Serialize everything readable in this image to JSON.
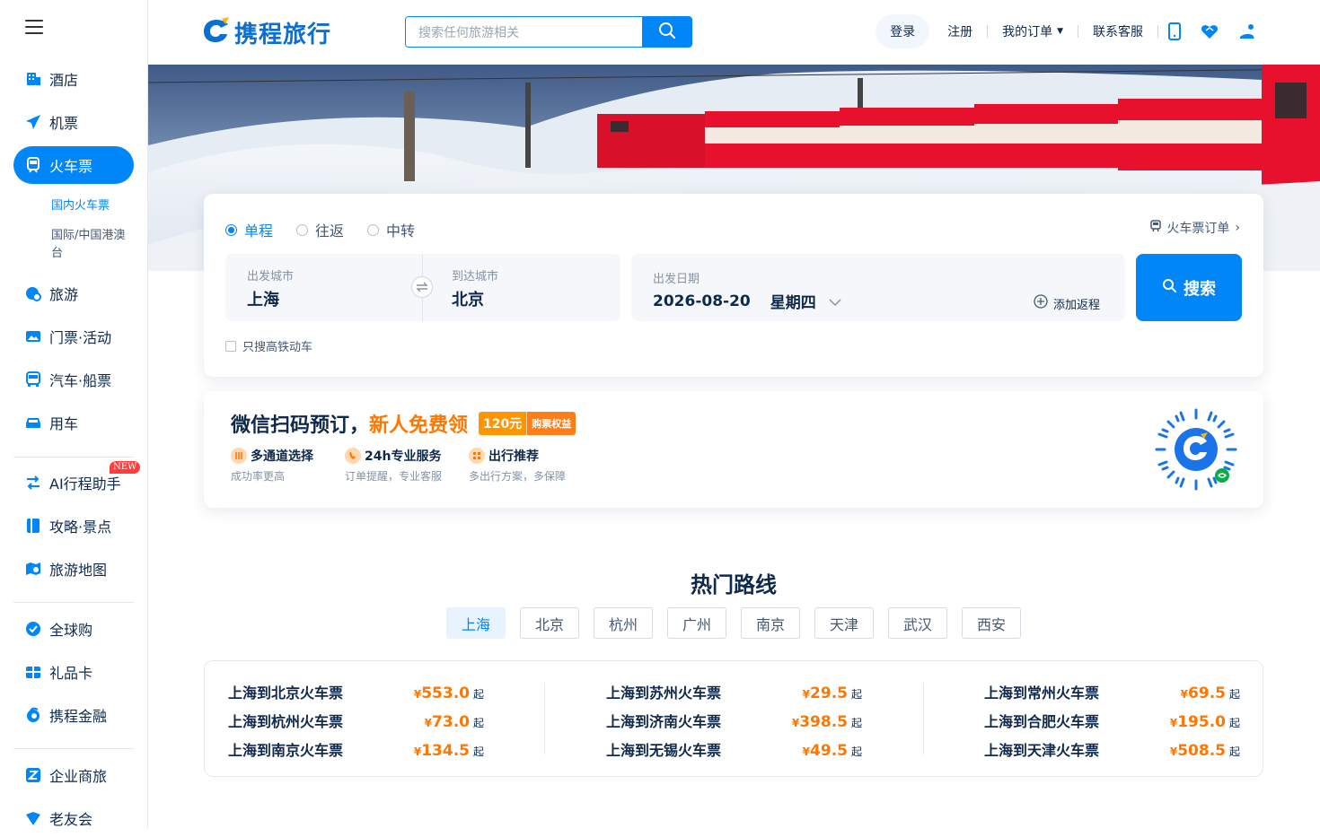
{
  "sidebar": {
    "items": [
      {
        "label": "酒店",
        "icon": "hotel-icon"
      },
      {
        "label": "机票",
        "icon": "plane-icon"
      },
      {
        "label": "火车票",
        "icon": "train-icon",
        "active": true
      },
      {
        "label": "旅游",
        "icon": "travel-icon"
      },
      {
        "label": "门票·活动",
        "icon": "ticket-icon"
      },
      {
        "label": "汽车·船票",
        "icon": "bus-icon"
      },
      {
        "label": "用车",
        "icon": "car-icon"
      },
      {
        "label": "AI行程助手",
        "icon": "ai-assistant-icon",
        "badge": "NEW"
      },
      {
        "label": "攻略·景点",
        "icon": "guide-icon"
      },
      {
        "label": "旅游地图",
        "icon": "map-icon"
      },
      {
        "label": "全球购",
        "icon": "global-shop-icon"
      },
      {
        "label": "礼品卡",
        "icon": "gift-card-icon"
      },
      {
        "label": "携程金融",
        "icon": "finance-icon"
      },
      {
        "label": "企业商旅",
        "icon": "business-icon"
      },
      {
        "label": "老友会",
        "icon": "member-icon"
      }
    ],
    "sub_items": [
      {
        "label": "国内火车票",
        "active": true
      },
      {
        "label": "国际/中国港澳台"
      }
    ],
    "new_badge": "NEW"
  },
  "header": {
    "logo_text": "携程旅行",
    "search_placeholder": "搜索任何旅游相关",
    "login": "登录",
    "register": "注册",
    "my_orders": "我的订单",
    "service": "联系客服"
  },
  "search": {
    "trip_types": [
      "单程",
      "往返",
      "中转"
    ],
    "orders_link": "火车票订单",
    "from_label": "出发城市",
    "from_value": "上海",
    "to_label": "到达城市",
    "to_value": "北京",
    "date_label": "出发日期",
    "date_value": "2026-08-20",
    "weekday": "星期四",
    "add_return": "添加返程",
    "search_button": "搜索",
    "high_speed_only": "只搜高铁动车"
  },
  "promo": {
    "title_a": "微信扫码预订，",
    "title_b": "新人免费领",
    "badge_amount": "120元",
    "badge_text": "购票权益",
    "features": [
      {
        "title": "多通道选择",
        "desc": "成功率更高"
      },
      {
        "title": "24h专业服务",
        "desc": "订单提醒，专业客服"
      },
      {
        "title": "出行推荐",
        "desc": "多出行方案，多保障"
      }
    ]
  },
  "hot": {
    "title": "热门路线",
    "tabs": [
      "上海",
      "北京",
      "杭州",
      "广州",
      "南京",
      "天津",
      "武汉",
      "西安"
    ],
    "currency": "¥",
    "suffix": "起",
    "routes": [
      [
        {
          "name": "上海到北京火车票",
          "price": "553.0"
        },
        {
          "name": "上海到杭州火车票",
          "price": "73.0"
        },
        {
          "name": "上海到南京火车票",
          "price": "134.5"
        }
      ],
      [
        {
          "name": "上海到苏州火车票",
          "price": "29.5"
        },
        {
          "name": "上海到济南火车票",
          "price": "398.5"
        },
        {
          "name": "上海到无锡火车票",
          "price": "49.5"
        }
      ],
      [
        {
          "name": "上海到常州火车票",
          "price": "69.5"
        },
        {
          "name": "上海到合肥火车票",
          "price": "195.0"
        },
        {
          "name": "上海到天津火车票",
          "price": "508.5"
        }
      ]
    ]
  },
  "colors": {
    "primary": "#0086f6",
    "accent": "#ff7700",
    "text": "#0f294d"
  }
}
